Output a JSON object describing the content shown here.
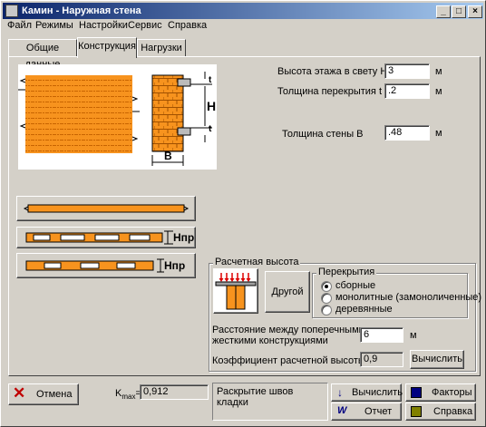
{
  "window": {
    "title": "Камин - Наружная стена"
  },
  "menu": [
    "Файл",
    "Режимы",
    "Настройки",
    "Сервис",
    "Справка"
  ],
  "tabs": [
    "Общие данные",
    "Конструкция",
    "Нагрузки"
  ],
  "active_tab": "Конструкция",
  "diagram": {
    "label_t_top": "t",
    "label_H": "H",
    "label_t_bottom": "t",
    "label_B": "B"
  },
  "slab_labels": {
    "hpr1": "Hпр",
    "hpr2": "Hпр"
  },
  "fields": {
    "floor_height": {
      "label": "Высота этажа в свету H",
      "value": "3",
      "unit": "м"
    },
    "slab_thickness": {
      "label": "Толщина перекрытия t",
      "value": ".2",
      "unit": "м"
    },
    "wall_thickness": {
      "label": "Толщина стены B",
      "value": ".48",
      "unit": "м"
    }
  },
  "design_height": {
    "group_title": "Расчетная высота",
    "other_button": "Другой",
    "slabs_group": {
      "title": "Перекрытия",
      "options": [
        "сборные",
        "монолитные (замоноличенные)",
        "деревянные"
      ],
      "selected": "сборные"
    },
    "distance": {
      "label_line1": "Расстояние между поперечными",
      "label_line2": "жесткими конструкциями",
      "value": "6",
      "unit": "м"
    },
    "coef": {
      "label": "Коэффициент расчетной высоты",
      "value": "0,9",
      "button": "Вычислить"
    }
  },
  "footer": {
    "cancel": "Отмена",
    "kmax_label": "K",
    "kmax_sub": "max",
    "kmax_suffix": "=",
    "kmax_value": "0,912",
    "status": "Раскрытие швов кладки",
    "calc": "Вычислить",
    "factors": "Факторы",
    "report": "Отчет",
    "help": "Справка"
  }
}
